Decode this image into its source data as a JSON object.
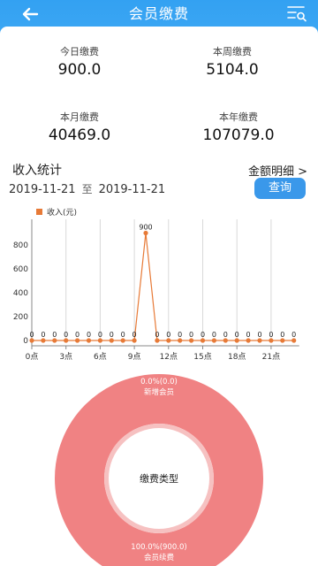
{
  "header": {
    "title": "会员缴费"
  },
  "stats": {
    "today": {
      "label": "今日缴费",
      "value": "900.0"
    },
    "week": {
      "label": "本周缴费",
      "value": "5104.0"
    },
    "month": {
      "label": "本月缴费",
      "value": "40469.0"
    },
    "year": {
      "label": "本年缴费",
      "value": "107079.0"
    }
  },
  "income": {
    "title": "收入统计",
    "detail_link": "金额明细 >",
    "date_from": "2019-11-21",
    "date_sep": "至",
    "date_to": "2019-11-21",
    "query_button": "查询"
  },
  "colors": {
    "header": "#3aa6f4",
    "accent": "#3a98ea",
    "series": "#e77a37",
    "donut": "#f08283"
  },
  "icons": {
    "back": "arrow-left-icon",
    "menu": "list-search-icon"
  },
  "chart_data": [
    {
      "type": "line",
      "legend": "收入(元)",
      "x": [
        0,
        1,
        2,
        3,
        4,
        5,
        6,
        7,
        8,
        9,
        10,
        11,
        12,
        13,
        14,
        15,
        16,
        17,
        18,
        19,
        20,
        21,
        22,
        23
      ],
      "x_tick_labels": [
        "0点",
        "3点",
        "6点",
        "9点",
        "12点",
        "15点",
        "18点",
        "21点"
      ],
      "y_ticks": [
        0,
        200,
        400,
        600,
        800
      ],
      "ylim": [
        0,
        950
      ],
      "grid": true,
      "series": [
        {
          "name": "收入(元)",
          "values": [
            0,
            0,
            0,
            0,
            0,
            0,
            0,
            0,
            0,
            0,
            900,
            0,
            0,
            0,
            0,
            0,
            0,
            0,
            0,
            0,
            0,
            0,
            0,
            0
          ]
        }
      ]
    },
    {
      "type": "pie",
      "center_label": "缴费类型",
      "slices": [
        {
          "name": "新增会员",
          "value": 0.0,
          "label": "0.0%(0.0)"
        },
        {
          "name": "会员续费",
          "value": 900.0,
          "label": "100.0%(900.0)"
        }
      ]
    }
  ]
}
